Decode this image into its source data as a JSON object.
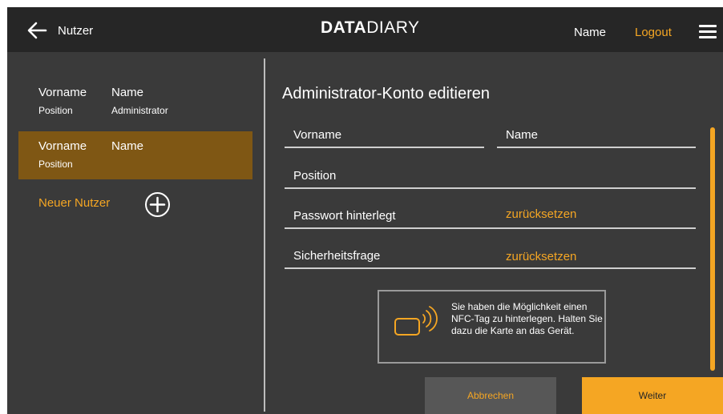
{
  "header": {
    "back_label": "Nutzer",
    "logo_bold": "DATA",
    "logo_light": "DIARY",
    "user_name": "Name",
    "logout_label": "Logout"
  },
  "sidebar": {
    "users": [
      {
        "first": "Vorname",
        "last": "Name",
        "position": "Position",
        "role": "Administrator",
        "active": false
      },
      {
        "first": "Vorname",
        "last": "Name",
        "position": "Position",
        "role": "",
        "active": true
      }
    ],
    "new_user_label": "Neuer Nutzer"
  },
  "form": {
    "title": "Administrator-Konto editieren",
    "first_name_label": "Vorname",
    "last_name_label": "Name",
    "position_label": "Position",
    "password_label": "Passwort hinterlegt",
    "password_action": "zurücksetzen",
    "security_label": "Sicherheitsfrage",
    "security_action": "zurücksetzen"
  },
  "nfc": {
    "text": "Sie haben die Möglichkeit einen NFC-Tag zu hinterlegen. Halten Sie dazu die Karte an das Gerät."
  },
  "buttons": {
    "cancel_label": "Abbrechen",
    "next_label": "Weiter"
  },
  "colors": {
    "accent": "#f5a623",
    "header_bg": "#262626",
    "panel_bg": "#3a3a3a",
    "active_item_bg": "#7f5714"
  },
  "icons": {
    "back": "arrow-left-icon",
    "menu": "hamburger-menu-icon",
    "add": "plus-circle-icon",
    "nfc": "nfc-card-icon"
  }
}
